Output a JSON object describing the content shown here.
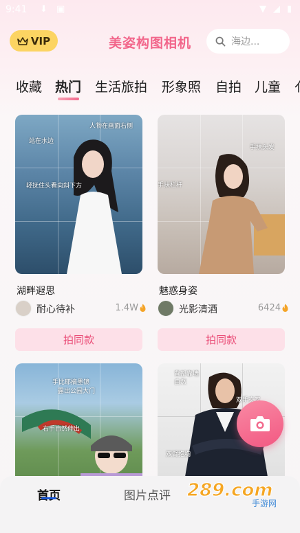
{
  "status_bar": {
    "time": "9:41"
  },
  "header": {
    "vip_label": "VIP",
    "app_title": "美姿构图相机",
    "search_placeholder": "海边..."
  },
  "tabs": [
    {
      "label": "收藏",
      "active": false
    },
    {
      "label": "热门",
      "active": true
    },
    {
      "label": "生活旅拍",
      "active": false
    },
    {
      "label": "形象照",
      "active": false
    },
    {
      "label": "自拍",
      "active": false
    },
    {
      "label": "儿童",
      "active": false
    }
  ],
  "cards": [
    {
      "title": "湖畔遐思",
      "author": "耐心待补",
      "likes": "1.4W",
      "button": "拍同款",
      "hints": [
        "人物在画面右侧",
        "站在水边",
        "轻抚住头看向斜下方"
      ]
    },
    {
      "title": "魅惑身姿",
      "author": "光影清酒",
      "likes": "6424",
      "button": "拍同款",
      "hints": [
        "手扶头发",
        "手扶栏杆"
      ]
    },
    {
      "title": "",
      "hints": [
        "手比耶摘墨镜",
        "露出公园大门",
        "右手自然伸出"
      ]
    },
    {
      "title": "",
      "hints": [
        "背部靠墙",
        "自然",
        "双手交叉",
        "双臂抱胸"
      ]
    }
  ],
  "bottom_nav": [
    {
      "label": "首页",
      "active": true
    },
    {
      "label": "图片点评",
      "active": false
    }
  ],
  "watermark": {
    "text": "289.com",
    "sub": "手游网"
  },
  "colors": {
    "accent": "#f2668b",
    "vip": "#fcd462",
    "button_bg": "#fde0e8",
    "button_text": "#ea4e78"
  }
}
